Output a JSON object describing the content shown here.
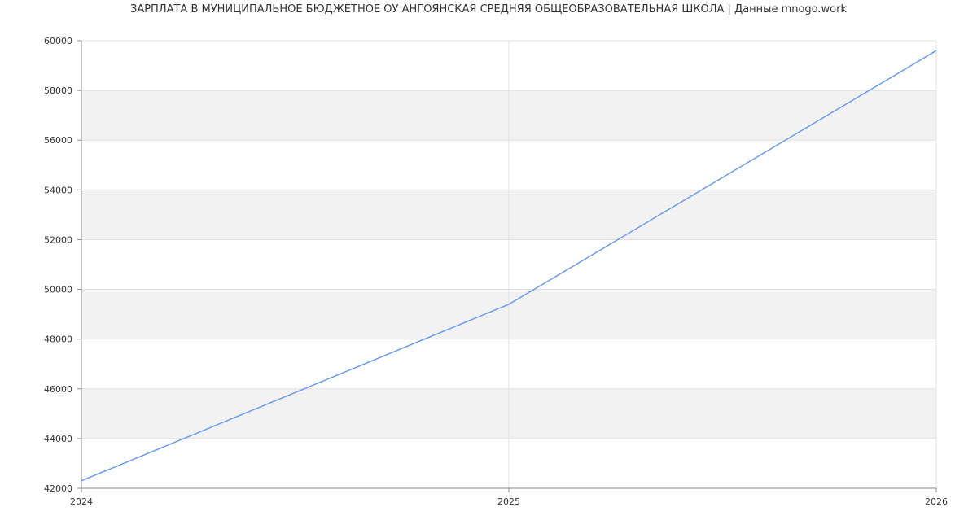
{
  "chart_data": {
    "type": "line",
    "title": "ЗАРПЛАТА В МУНИЦИПАЛЬНОЕ БЮДЖЕТНОЕ ОУ АНГОЯНСКАЯ СРЕДНЯЯ ОБЩЕОБРАЗОВАТЕЛЬНАЯ ШКОЛА | Данные mnogo.work",
    "xlabel": "",
    "ylabel": "",
    "x": [
      "2024",
      "2025",
      "2026"
    ],
    "x_ticks": [
      "2024",
      "2025",
      "2026"
    ],
    "y_ticks": [
      "42000",
      "44000",
      "46000",
      "48000",
      "50000",
      "52000",
      "54000",
      "56000",
      "58000",
      "60000"
    ],
    "ylim": [
      42000,
      60000
    ],
    "grid": true,
    "series": [
      {
        "values": [
          42300,
          49400,
          59600
        ],
        "color": "#6b9cec"
      }
    ],
    "band_color": "#f2f2f2",
    "grid_color": "#e0e0e0",
    "axis_color": "#888888"
  }
}
